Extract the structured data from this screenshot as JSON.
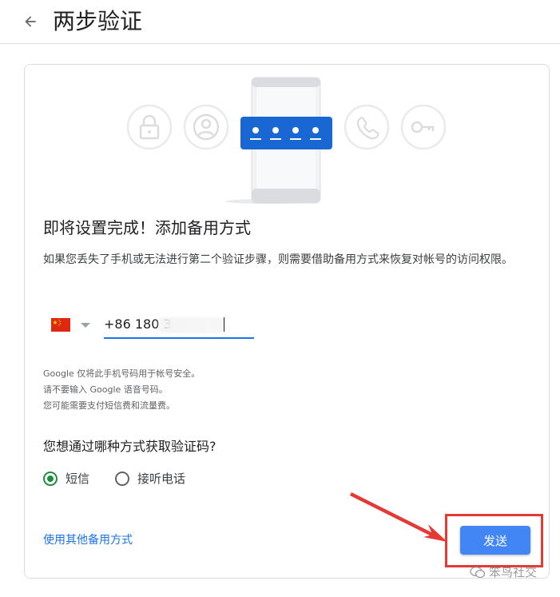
{
  "header": {
    "back_icon": "arrow-left-icon",
    "title": "两步验证"
  },
  "illustration": {
    "icons": [
      "lock-icon",
      "person-icon",
      "password-dots-icon",
      "phone-icon",
      "key-icon"
    ],
    "accent": "#1a73e8"
  },
  "setup": {
    "heading": "即将设置完成！添加备用方式",
    "description": "如果您丢失了手机或无法进行第二个验证步骤，则需要借助备用方式来恢复对帐号的访问权限。"
  },
  "phone": {
    "country_flag": "china-flag-icon",
    "value": "+86 180 3"
  },
  "notes": {
    "line1": "Google 仅将此手机号码用于帐号安全。",
    "line2": "请不要输入 Google 语音号码。",
    "line3": "您可能需要支付短信费和流量费。"
  },
  "method": {
    "question": "您想通过哪种方式获取验证码?",
    "options": [
      {
        "label": "短信",
        "selected": true
      },
      {
        "label": "接听电话",
        "selected": false
      }
    ]
  },
  "actions": {
    "other_link": "使用其他备用方式",
    "send": "发送"
  },
  "watermark": {
    "text": "笨鸟社交"
  },
  "colors": {
    "primary_button": "#4285f4",
    "link": "#1a73e8",
    "radio_selected": "#1e8e3e",
    "annotation": "#e53935"
  }
}
